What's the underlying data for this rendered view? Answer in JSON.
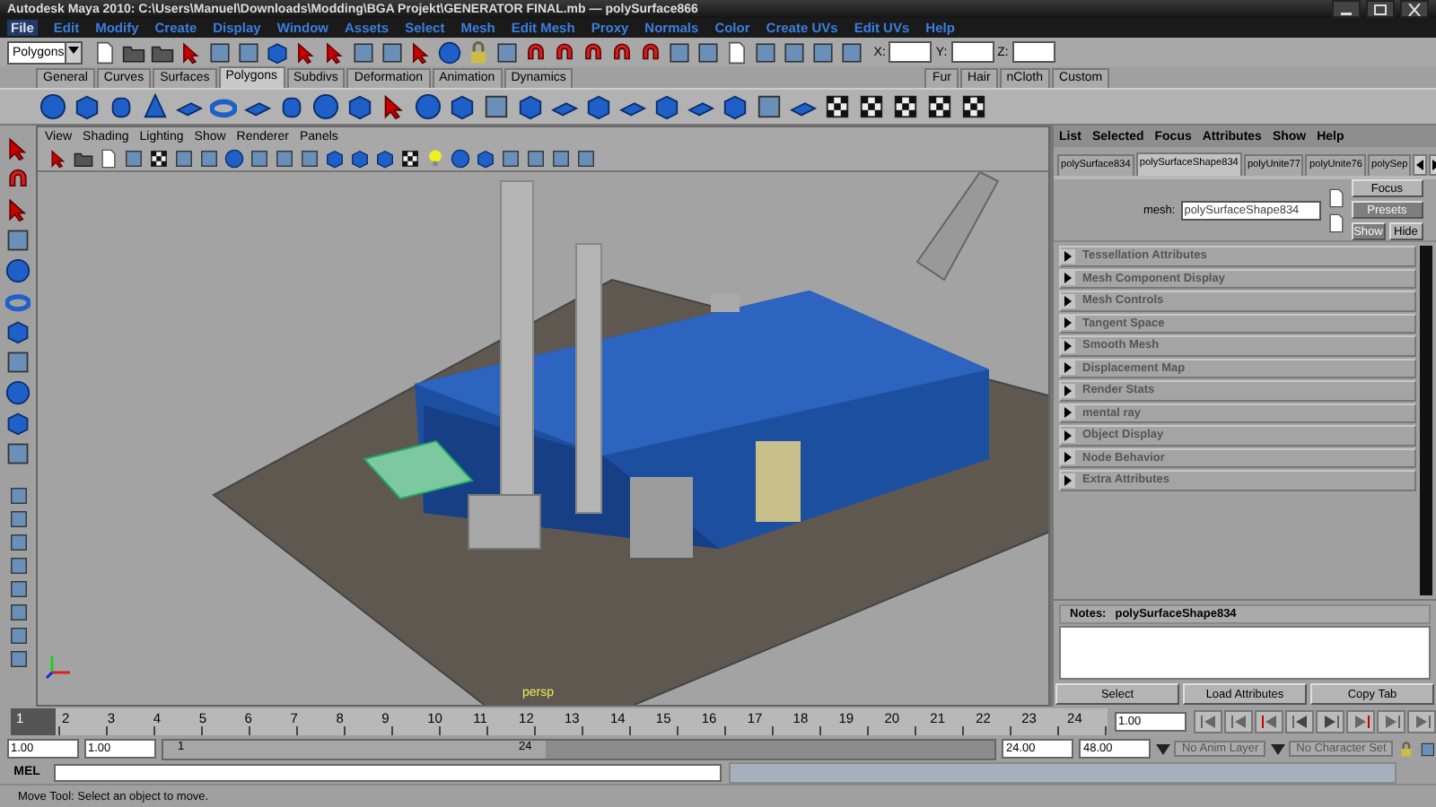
{
  "window": {
    "title": "Autodesk Maya 2010: C:\\Users\\Manuel\\Downloads\\Modding\\BGA Projekt\\GENERATOR FINAL.mb  —  polySurface866"
  },
  "menu_bar": [
    {
      "label": "File",
      "selected": true
    },
    {
      "label": "Edit",
      "selected": false
    },
    {
      "label": "Modify",
      "selected": false
    },
    {
      "label": "Create",
      "selected": false
    },
    {
      "label": "Display",
      "selected": false
    },
    {
      "label": "Window",
      "selected": false
    },
    {
      "label": "Assets",
      "selected": false
    },
    {
      "label": "Select",
      "selected": false
    },
    {
      "label": "Mesh",
      "selected": false
    },
    {
      "label": "Edit Mesh",
      "selected": false
    },
    {
      "label": "Proxy",
      "selected": false
    },
    {
      "label": "Normals",
      "selected": false
    },
    {
      "label": "Color",
      "selected": false
    },
    {
      "label": "Create UVs",
      "selected": false
    },
    {
      "label": "Edit UVs",
      "selected": false
    },
    {
      "label": "Help",
      "selected": false
    }
  ],
  "status_line": {
    "menu_set": "Polygons",
    "x_label": "X:",
    "y_label": "Y:",
    "z_label": "Z:"
  },
  "shelf_tabs": [
    {
      "label": "General",
      "selected": false
    },
    {
      "label": "Curves",
      "selected": false
    },
    {
      "label": "Surfaces",
      "selected": false
    },
    {
      "label": "Polygons",
      "selected": true
    },
    {
      "label": "Subdivs",
      "selected": false
    },
    {
      "label": "Deformation",
      "selected": false
    },
    {
      "label": "Animation",
      "selected": false
    },
    {
      "label": "Dynamics",
      "selected": false
    },
    {
      "label": "Fur",
      "selected": false
    },
    {
      "label": "Hair",
      "selected": false
    },
    {
      "label": "nCloth",
      "selected": false
    },
    {
      "label": "Custom",
      "selected": false
    }
  ],
  "viewport": {
    "menu": [
      "View",
      "Shading",
      "Lighting",
      "Show",
      "Renderer",
      "Panels"
    ],
    "camera": "persp"
  },
  "attribute_editor": {
    "menu": [
      "List",
      "Selected",
      "Focus",
      "Attributes",
      "Show",
      "Help"
    ],
    "tabs": [
      {
        "label": "polySurface834",
        "selected": false
      },
      {
        "label": "polySurfaceShape834",
        "selected": true
      },
      {
        "label": "polyUnite77",
        "selected": false
      },
      {
        "label": "polyUnite76",
        "selected": false
      },
      {
        "label": "polySep",
        "selected": false
      }
    ],
    "mesh_label": "mesh:",
    "mesh_value": "polySurfaceShape834",
    "side_buttons": [
      {
        "label": "Focus",
        "disabled": false
      },
      {
        "label": "Presets",
        "disabled": true
      },
      {
        "label": "Show",
        "disabled": true
      },
      {
        "label": "Hide",
        "disabled": false
      }
    ],
    "sections": [
      {
        "label": "Tessellation Attributes",
        "expanded": false
      },
      {
        "label": "Mesh Component Display",
        "expanded": false
      },
      {
        "label": "Mesh Controls",
        "expanded": false
      },
      {
        "label": "Tangent Space",
        "expanded": false
      },
      {
        "label": "Smooth Mesh",
        "expanded": false
      },
      {
        "label": "Displacement Map",
        "expanded": false
      },
      {
        "label": "Render Stats",
        "expanded": false
      },
      {
        "label": "mental ray",
        "expanded": false
      },
      {
        "label": "Object Display",
        "expanded": false
      },
      {
        "label": "Node Behavior",
        "expanded": false
      },
      {
        "label": "Extra Attributes",
        "expanded": false
      }
    ],
    "notes_label": "Notes:",
    "notes_node": "polySurfaceShape834",
    "buttons": [
      "Select",
      "Load Attributes",
      "Copy Tab"
    ]
  },
  "timeline": {
    "ticks": [
      {
        "label": "1",
        "selected": true
      },
      {
        "label": "2",
        "selected": false
      },
      {
        "label": "3",
        "selected": false
      },
      {
        "label": "4",
        "selected": false
      },
      {
        "label": "5",
        "selected": false
      },
      {
        "label": "6",
        "selected": false
      },
      {
        "label": "7",
        "selected": false
      },
      {
        "label": "8",
        "selected": false
      },
      {
        "label": "9",
        "selected": false
      },
      {
        "label": "10",
        "selected": false
      },
      {
        "label": "11",
        "selected": false
      },
      {
        "label": "12",
        "selected": false
      },
      {
        "label": "13",
        "selected": false
      },
      {
        "label": "14",
        "selected": false
      },
      {
        "label": "15",
        "selected": false
      },
      {
        "label": "16",
        "selected": false
      },
      {
        "label": "17",
        "selected": false
      },
      {
        "label": "18",
        "selected": false
      },
      {
        "label": "19",
        "selected": false
      },
      {
        "label": "20",
        "selected": false
      },
      {
        "label": "21",
        "selected": false
      },
      {
        "label": "22",
        "selected": false
      },
      {
        "label": "23",
        "selected": false
      },
      {
        "label": "24",
        "selected": false
      }
    ],
    "current_field": "1.00"
  },
  "range_slider": {
    "level": 0.46,
    "start": "1.00",
    "range_start": "1.00",
    "slider_start": "1",
    "slider_end": "24",
    "range_end": "24.00",
    "end": "48.00",
    "anim_layer": "No Anim Layer",
    "character_set": "No Character Set"
  },
  "command_line": {
    "label": "MEL"
  },
  "help_line": "Move Tool: Select an object to move."
}
